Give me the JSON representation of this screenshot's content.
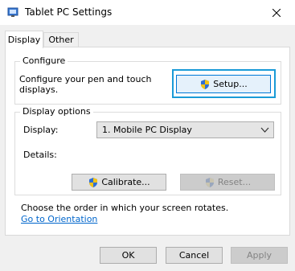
{
  "window": {
    "title": "Tablet PC Settings",
    "close_icon": "close-icon",
    "title_icon": "tablet-settings-icon"
  },
  "tabs": [
    {
      "label": "Display",
      "active": true
    },
    {
      "label": "Other",
      "active": false
    }
  ],
  "configure": {
    "group_label": "Configure",
    "description_line1": "Configure your pen and touch",
    "description_line2": "displays.",
    "setup_button": "Setup...",
    "setup_icon": "uac-shield-icon"
  },
  "display_options": {
    "group_label": "Display options",
    "display_label": "Display:",
    "display_value": "1. Mobile PC Display",
    "details_label": "Details:",
    "calibrate_button": "Calibrate...",
    "reset_button": "Reset...",
    "reset_enabled": false
  },
  "orientation": {
    "description": "Choose the order in which your screen rotates.",
    "link": "Go to Orientation"
  },
  "footer": {
    "ok": "OK",
    "cancel": "Cancel",
    "apply": "Apply",
    "apply_enabled": false
  },
  "colors": {
    "highlight": "#1a9bd7",
    "link": "#0066cc",
    "disabled_text": "#838383"
  }
}
